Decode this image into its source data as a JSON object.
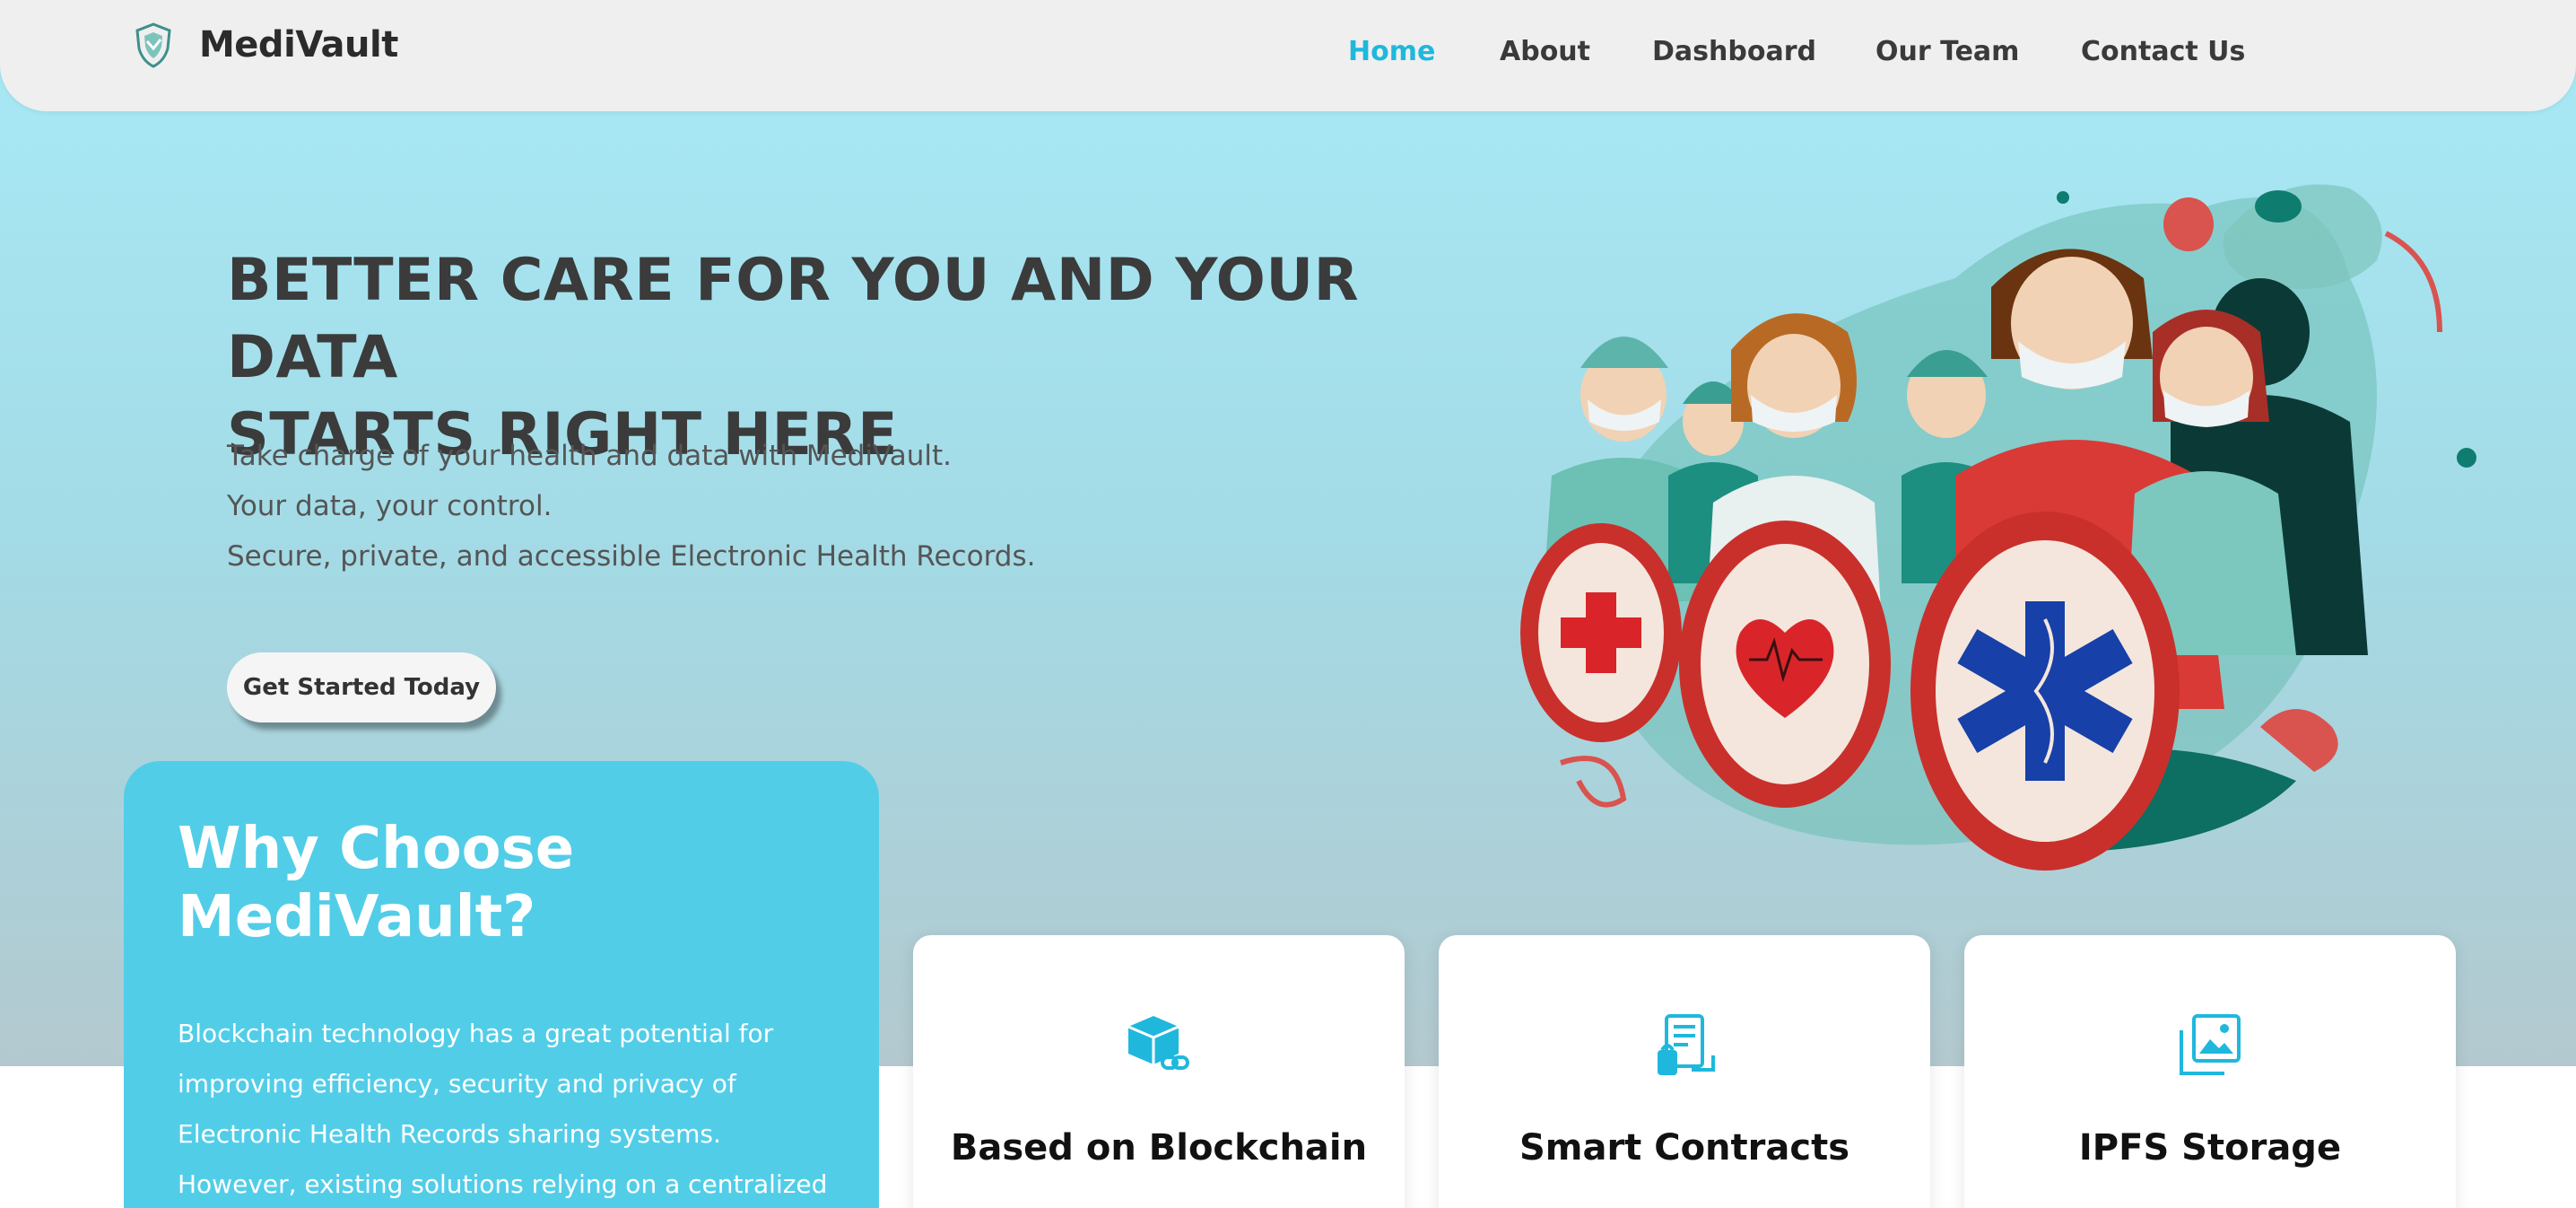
{
  "brand": {
    "name": "MediVault",
    "logo_icon": "shield-icon"
  },
  "nav": {
    "items": [
      {
        "label": "Home",
        "active": true
      },
      {
        "label": "About",
        "active": false
      },
      {
        "label": "Dashboard",
        "active": false
      },
      {
        "label": "Our Team",
        "active": false
      },
      {
        "label": "Contact Us",
        "active": false
      }
    ]
  },
  "hero": {
    "headline_line1": "BETTER CARE FOR YOU AND YOUR DATA",
    "headline_line2": "STARTS RIGHT HERE",
    "sub_lines": [
      "Take charge of your health and data with MediVault.",
      "Your data, your control.",
      "Secure, private, and accessible Electronic Health Records."
    ],
    "cta_label": "Get Started Today",
    "illustration": "medical-team-with-shields-illustration"
  },
  "why": {
    "title": "Why Choose MediVault?",
    "body": "Blockchain technology has a great potential for improving efficiency, security and privacy of Electronic Health Records sharing systems. However, existing solutions relying on a centralized"
  },
  "features": [
    {
      "title": "Based on Blockchain",
      "icon": "blockchain-cube-icon"
    },
    {
      "title": "Smart Contracts",
      "icon": "smart-contract-icon"
    },
    {
      "title": "IPFS Storage",
      "icon": "image-storage-icon"
    }
  ],
  "colors": {
    "accent": "#1fb8dc",
    "why_card": "#52cde8",
    "text_dark": "#3b3b3b",
    "navbar": "#efefef"
  }
}
